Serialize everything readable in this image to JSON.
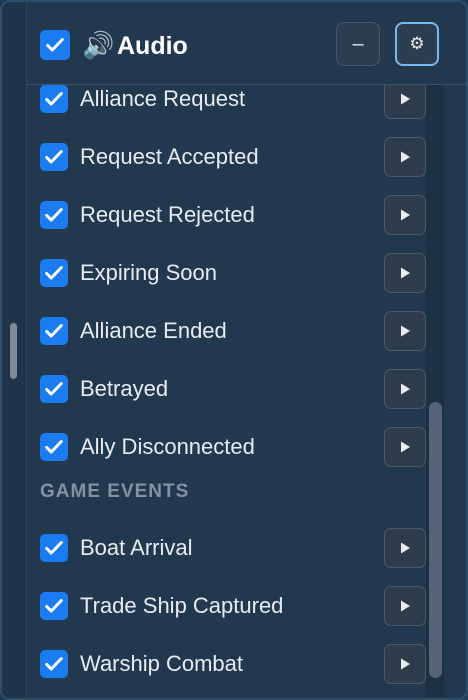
{
  "header": {
    "title": "Audio",
    "icon": "speaker-icon",
    "icon_glyph": "🔊",
    "enabled": true,
    "minimize_label": "–",
    "settings_glyph": "⚙"
  },
  "rows": [
    {
      "label": "Alliance Request",
      "checked": true
    },
    {
      "label": "Request Accepted",
      "checked": true
    },
    {
      "label": "Request Rejected",
      "checked": true
    },
    {
      "label": "Expiring Soon",
      "checked": true
    },
    {
      "label": "Alliance Ended",
      "checked": true
    },
    {
      "label": "Betrayed",
      "checked": true
    },
    {
      "label": "Ally Disconnected",
      "checked": true
    }
  ],
  "game_events": {
    "title": "GAME EVENTS",
    "rows": [
      {
        "label": "Boat Arrival",
        "checked": true
      },
      {
        "label": "Trade Ship Captured",
        "checked": true
      },
      {
        "label": "Warship Combat",
        "checked": true
      }
    ]
  },
  "colors": {
    "accent": "#1b7bf0",
    "panel": "#22384f",
    "text": "#e8ecf0",
    "section": "#8592a0"
  }
}
